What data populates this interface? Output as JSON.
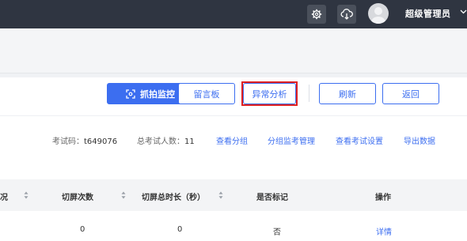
{
  "header": {
    "username": "超级管理员",
    "icons": [
      "gear-icon",
      "cloud-download-icon",
      "avatar",
      "chevron-down-icon"
    ]
  },
  "toolbar": {
    "capture_monitor": "抓拍监控",
    "message_board": "留言板",
    "anomaly_analysis": "异常分析",
    "refresh": "刷新",
    "back": "返回"
  },
  "exam_info": {
    "code_label": "考试码：",
    "code_value": "t649076",
    "total_label": "总考试人数：",
    "total_value": "11"
  },
  "links": {
    "view_groups": "查看分组",
    "group_monitor_manage": "分组监考管理",
    "view_exam_settings": "查看考试设置",
    "export_data": "导出数据"
  },
  "table": {
    "headers": [
      "况",
      "切屏次数",
      "切屏总时长（秒）",
      "是否标记",
      "操作"
    ],
    "rows": [
      {
        "switch_count": "0",
        "switch_duration": "0",
        "marked": "否",
        "action": "详情"
      }
    ]
  },
  "colors": {
    "accent": "#3c6ef0",
    "topbar": "#2f3541",
    "highlight": "#e02020"
  }
}
